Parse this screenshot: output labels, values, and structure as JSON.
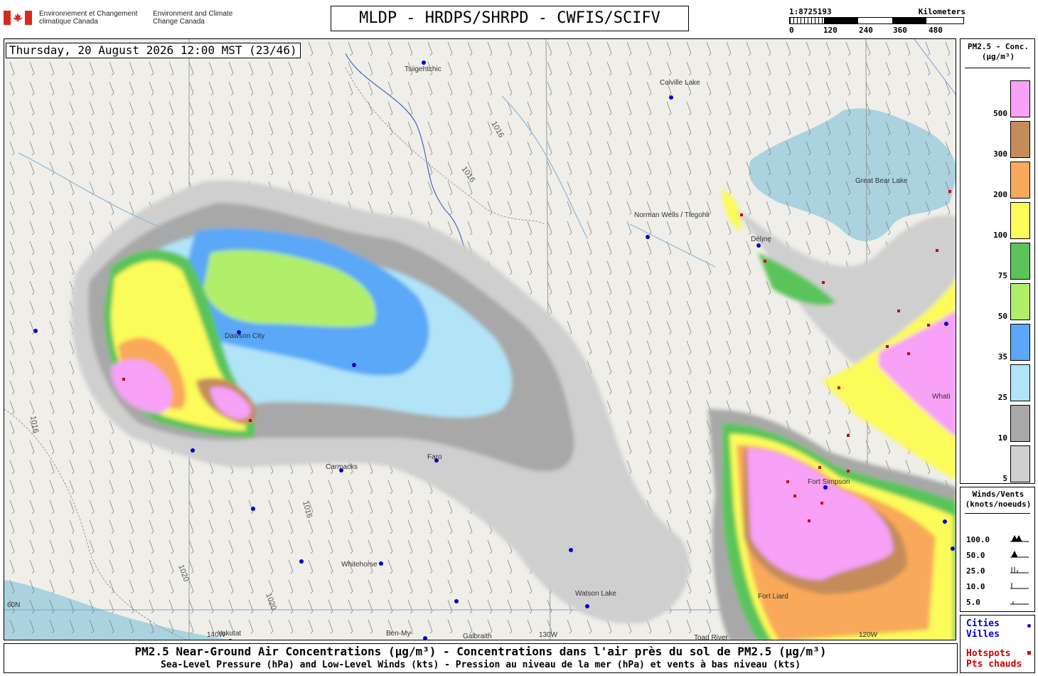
{
  "header": {
    "gov_fr": "Environnement et Changement climatique Canada",
    "gov_en": "Environment and Climate Change Canada",
    "title": "MLDP - HRDPS/SHRPD - CWFIS/SCIFV"
  },
  "scale": {
    "ratio": "1:8725193",
    "units": "Kilometers",
    "ticks": [
      "0",
      "120",
      "240",
      "360",
      "480"
    ]
  },
  "map": {
    "timestamp": "Thursday, 20 August 2026 12:00 MST (23/46)",
    "places": [
      "Tsiigehtchic",
      "Colville Lake",
      "Great Bear Lake",
      "Norman Wells / Tlegohli",
      "Dawson City",
      "Carmacks",
      "Faro",
      "Whitehorse",
      "Watson Lake",
      "Yakutat",
      "Ben-My-",
      "Galbraith",
      "Toad River",
      "Fort Simpson",
      "Whati",
      "Délı̨nę",
      "Fort Liard"
    ],
    "isobar_label": "1016",
    "isobar_label_2": "1020",
    "longitudes": [
      "130W",
      "120W",
      "140W"
    ],
    "lat_label": "60N"
  },
  "legend_conc": {
    "title_line1": "PM2.5 - Conc.",
    "title_line2": "(µg/m³)",
    "levels": [
      {
        "label": "500",
        "color": "#f7a1f7"
      },
      {
        "label": "300",
        "color": "#c58c5a"
      },
      {
        "label": "200",
        "color": "#f9a95a"
      },
      {
        "label": "100",
        "color": "#fbfb5a"
      },
      {
        "label": "75",
        "color": "#5ac45a"
      },
      {
        "label": "50",
        "color": "#b1ef6a"
      },
      {
        "label": "35",
        "color": "#5aa8f7"
      },
      {
        "label": "25",
        "color": "#b1e4f7"
      },
      {
        "label": "10",
        "color": "#a8a8a8"
      },
      {
        "label": "5",
        "color": "#cfcfcf"
      }
    ]
  },
  "legend_wind": {
    "title_line1": "Winds/Vents",
    "title_line2": "(knots/noeuds)",
    "rows": [
      "100.0",
      "50.0",
      "25.0",
      "10.0",
      "5.0"
    ]
  },
  "legend_cities": {
    "cities_en": "Cities",
    "cities_fr": "Villes",
    "hotspots_en": "Hotspots",
    "hotspots_fr": "Pts chauds",
    "city_color": "#0000cc",
    "hotspot_color": "#cc0000"
  },
  "caption": {
    "line1": "PM2.5 Near-Ground Air Concentrations (µg/m³) - Concentrations dans l'air près du sol de PM2.5 (µg/m³)",
    "line2": "Sea-Level Pressure (hPa) and Low-Level Winds (kts) - Pression au niveau de la mer (hPa) et vents à bas niveau (kts)"
  }
}
